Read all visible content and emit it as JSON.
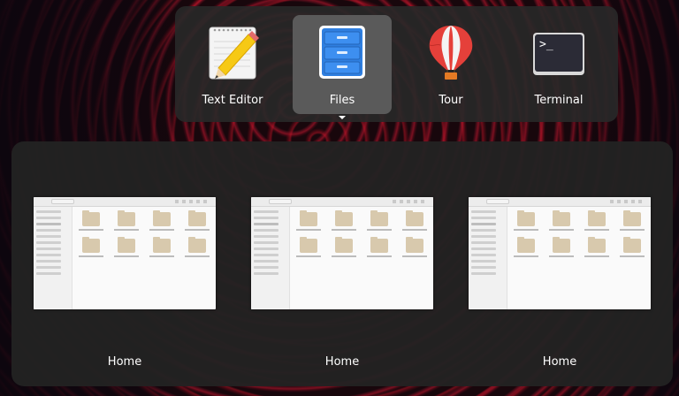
{
  "app_switcher": {
    "apps": [
      {
        "label": "Text Editor",
        "icon": "text-editor-icon",
        "selected": false
      },
      {
        "label": "Files",
        "icon": "files-icon",
        "selected": true
      },
      {
        "label": "Tour",
        "icon": "balloon-icon",
        "selected": false
      },
      {
        "label": "Terminal",
        "icon": "terminal-icon",
        "selected": false
      }
    ],
    "terminal_prompt": ">_"
  },
  "windows": {
    "items": [
      {
        "title": "Home"
      },
      {
        "title": "Home"
      },
      {
        "title": "Home"
      }
    ]
  },
  "colors": {
    "switcher_bg": "#282828",
    "selected_bg": "#5a5a5a",
    "panel_bg": "#222222",
    "wallpaper_accent": "#c81428"
  }
}
